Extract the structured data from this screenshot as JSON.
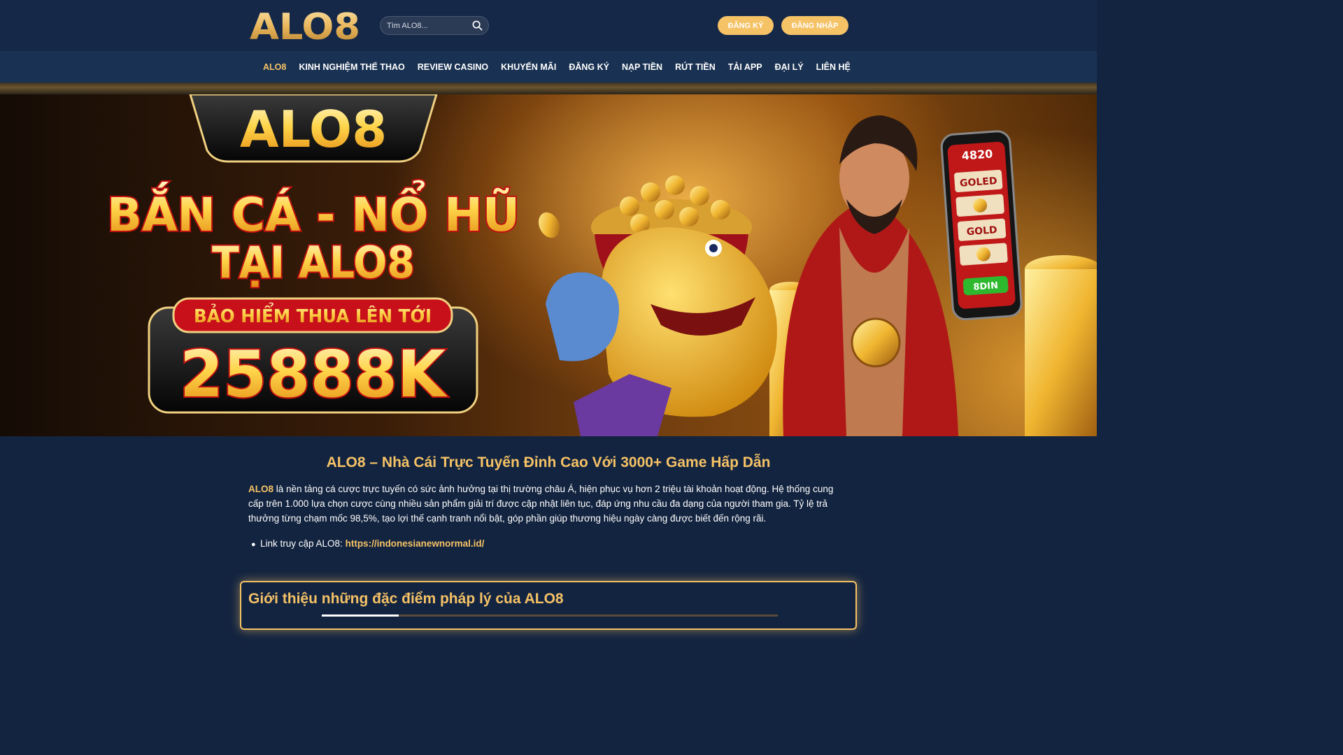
{
  "header": {
    "logo_text": "ALO8",
    "search_placeholder": "Tìm ALO8...",
    "register_label": "ĐĂNG KÝ",
    "login_label": "ĐĂNG NHẬP"
  },
  "nav": {
    "items": [
      {
        "label": "ALO8",
        "active": true
      },
      {
        "label": "KINH NGHIỆM THỂ THAO"
      },
      {
        "label": "REVIEW CASINO"
      },
      {
        "label": "KHUYẾN MÃI"
      },
      {
        "label": "ĐĂNG KÝ"
      },
      {
        "label": "NẠP TIỀN"
      },
      {
        "label": "RÚT TIỀN"
      },
      {
        "label": "TẢI APP"
      },
      {
        "label": "ĐẠI LÝ"
      },
      {
        "label": "LIÊN HỆ"
      }
    ]
  },
  "banner": {
    "logo_text": "ALO8",
    "headline_line1": "BẮN CÁ - NỔ HŨ",
    "headline_line2": "TẠI ALO8",
    "insurance_label": "BẢO HIỂM THUA LÊN TỚI",
    "amount": "25888K",
    "phone_amount": "4820",
    "phone_reel_1": "GOLED",
    "phone_reel_2": "GOLD",
    "phone_button": "8DIN"
  },
  "main": {
    "title": "ALO8 – Nhà Cái Trực Tuyến Đỉnh Cao Với 3000+ Game Hấp Dẫn",
    "intro_brand": "ALO8",
    "intro_text": " là nền tảng cá cược trực tuyến có sức ảnh hưởng tại thị trường châu Á, hiện phục vụ hơn 2 triệu tài khoản hoạt động. Hệ thống cung cấp trên 1.000 lựa chọn cược cùng nhiều sản phẩm giải trí được cập nhật liên tục, đáp ứng nhu cầu đa dạng của người tham gia. Tỷ lệ trả thưởng từng chạm mốc 98,5%, tạo lợi thế cạnh tranh nổi bật, góp phần giúp thương hiệu ngày càng được biết đến rộng rãi.",
    "link_prefix": "Link truy cập ALO8: ",
    "link_url": "https://indonesianewnormal.id/",
    "section_title": "Giới thiệu những đặc điểm pháp lý của ALO8"
  },
  "colors": {
    "accent": "#f5c266",
    "background": "#132440",
    "header_bg": "#152848"
  }
}
